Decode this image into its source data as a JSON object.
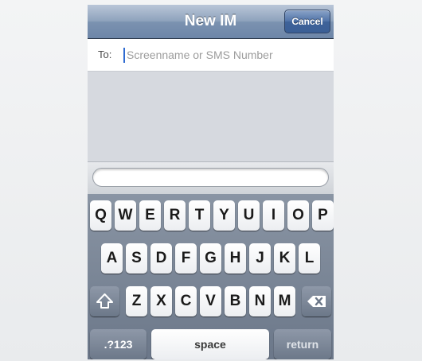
{
  "nav": {
    "title": "New IM",
    "cancel_label": "Cancel"
  },
  "recipient": {
    "label": "To:",
    "placeholder": "Screenname or SMS Number"
  },
  "keyboard": {
    "row1": [
      "Q",
      "W",
      "E",
      "R",
      "T",
      "Y",
      "U",
      "I",
      "O",
      "P"
    ],
    "row2": [
      "A",
      "S",
      "D",
      "F",
      "G",
      "H",
      "J",
      "K",
      "L"
    ],
    "row3": [
      "Z",
      "X",
      "C",
      "V",
      "B",
      "N",
      "M"
    ],
    "shift_icon": "shift-arrow-icon",
    "delete_icon": "backspace-icon",
    "numbers_label": ".?123",
    "space_label": "space",
    "return_label": "return"
  }
}
